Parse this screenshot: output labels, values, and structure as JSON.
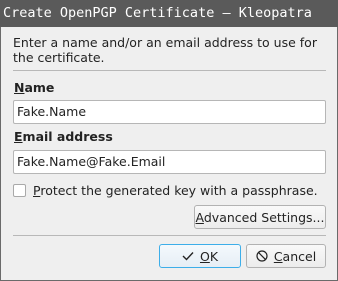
{
  "window": {
    "title": "Create OpenPGP Certificate — Kleopatra"
  },
  "intro_text": "Enter a name and/or an email address to use for the certificate.",
  "name_field": {
    "label_accel": "N",
    "label_rest": "ame",
    "value": "Fake.Name"
  },
  "email_field": {
    "label_accel": "E",
    "label_rest": "mail address",
    "value": "Fake.Name@Fake.Email"
  },
  "passphrase_checkbox": {
    "label_accel": "P",
    "label_rest": "rotect the generated key with a passphrase.",
    "checked": false
  },
  "advanced_button": {
    "label_accel": "A",
    "label_rest": "dvanced Settings..."
  },
  "ok_button": {
    "icon": "checkmark-icon",
    "label_accel": "O",
    "label_rest": "K"
  },
  "cancel_button": {
    "icon": "cancel-icon",
    "label_accel": "C",
    "label_rest": "ancel"
  }
}
